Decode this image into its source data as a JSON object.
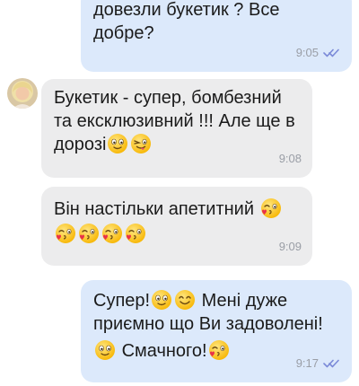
{
  "messages": [
    {
      "direction": "outgoing",
      "text_lines": [
        "довезли букетик ? Все",
        "добре?"
      ],
      "time": "9:05",
      "status_icon": "double-check-icon"
    },
    {
      "direction": "incoming",
      "avatar_icon": "avatar-photo",
      "text_lines": [
        "Букетик - супер, бомбезний",
        "та ексклюзивний !!! Але ще в",
        "дорозі"
      ],
      "emoji": [
        "smiling-face-icon",
        "winking-tongue-face-icon"
      ],
      "time": "9:08"
    },
    {
      "direction": "incoming",
      "text_lines": [
        "Він настільки апетитний"
      ],
      "emoji": [
        "kissing-heart-face-icon",
        "kissing-heart-face-icon",
        "kissing-heart-face-icon",
        "kissing-heart-face-icon",
        "kissing-heart-face-icon"
      ],
      "time": "9:09"
    },
    {
      "direction": "outgoing",
      "text_lines": [
        "Супер!",
        "Мені дуже",
        "приємно що Ви задоволені!",
        "Смачного!"
      ],
      "emoji": [
        "smiling-face-icon",
        "happy-face-icon",
        "smiling-face-icon",
        "kissing-heart-face-icon"
      ],
      "time": "9:17",
      "status_icon": "double-check-icon"
    }
  ],
  "colors": {
    "outgoing_bubble": "#dce9fb",
    "incoming_bubble": "#ececed",
    "time_text": "#9a9ea6",
    "read_ticks": "#7b8ad8",
    "emoji_yellow": "#ffcc33",
    "heart_red": "#e8304a"
  }
}
